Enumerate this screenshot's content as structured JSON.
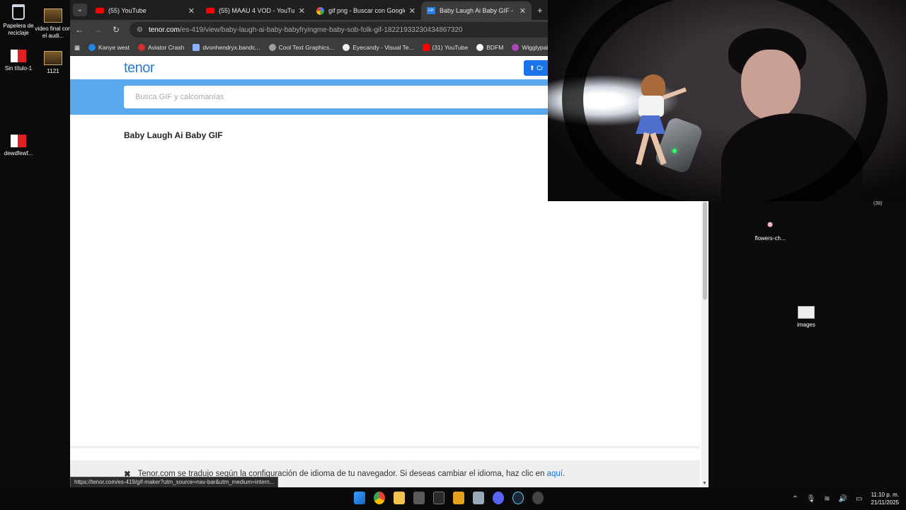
{
  "desktop": {
    "icons": [
      {
        "label": "Papelera de reciclaje"
      },
      {
        "label": "video final con el audi..."
      },
      {
        "label": "Sin título-1"
      },
      {
        "label": "1121"
      },
      {
        "label": "dewdfewf..."
      },
      {
        "label": "flowers-ch..."
      },
      {
        "label": "images"
      }
    ],
    "badge": "(38)"
  },
  "browser": {
    "tabs": [
      {
        "title": "(55) YouTube"
      },
      {
        "title": "(55) MAAU 4 VOD - YouTube"
      },
      {
        "title": "gif png - Buscar con Google"
      },
      {
        "title": "Baby Laugh Ai Baby GIF - Baby"
      }
    ],
    "new_tab": "+",
    "url_host": "tenor.com",
    "url_path": "/es-419/view/baby-laugh-ai-baby-babyfryingme-baby-sob-folk-gif-18221933230434867320",
    "bookmarks": [
      {
        "label": "Kanye west"
      },
      {
        "label": "Aviator Crash"
      },
      {
        "label": "dvonhendryx.bandc..."
      },
      {
        "label": "Cool Text Graphics..."
      },
      {
        "label": "Eyecandy - Visual Te..."
      },
      {
        "label": "(31) YouTube"
      },
      {
        "label": "BDFM"
      },
      {
        "label": "Wigglypaint – H"
      }
    ],
    "status_url": "https://tenor.com/es-419/gif-maker?utm_source=nav-bar&utm_medium=intern..."
  },
  "tenor": {
    "logo": "tenor",
    "create_label": "Cr",
    "search_placeholder": "Busca GIF y calcomanías",
    "gif_title": "Baby Laugh Ai Baby GIF",
    "translate_text": "Tenor.com se tradujo según la configuración de idioma de tu navegador. Si deseas cambiar el idioma, haz clic en",
    "translate_link": "aquí",
    "translate_end": "."
  },
  "taskbar": {
    "time": "11:10 p. m.",
    "date": "21/11/2025"
  },
  "colors": {
    "tenor_blue": "#2b7bd8",
    "search_band": "#5aa9ee",
    "chrome_dark": "#1f1f1f"
  }
}
